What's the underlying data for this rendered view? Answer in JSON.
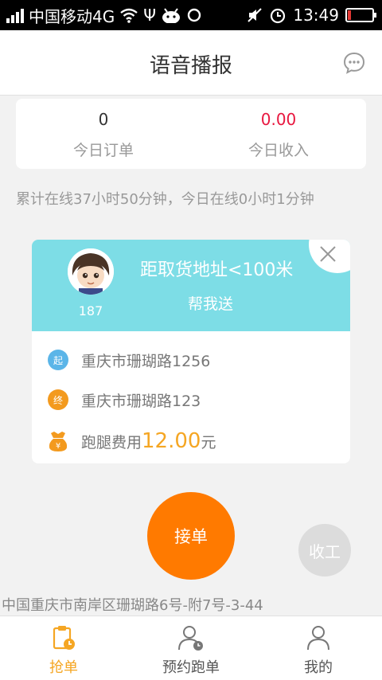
{
  "statusbar": {
    "carrier": "中国移动4G",
    "time": "13:49"
  },
  "header": {
    "title": "语音播报"
  },
  "stats": {
    "orders_value": "0",
    "orders_label": "今日订单",
    "income_value": "0.00",
    "income_label": "今日收入"
  },
  "online_text": "累计在线37小时50分钟，今日在线0小时1分钟",
  "order_card": {
    "user_id": "187",
    "distance": "距取货地址<100米",
    "type": "帮我送",
    "start_icon": "起",
    "start_address": "重庆市珊瑚路1256",
    "end_icon": "终",
    "end_address": "重庆市珊瑚路123",
    "fee_label": "跑腿费用",
    "fee_value": "12.00",
    "fee_unit": "元"
  },
  "actions": {
    "accept": "接单",
    "finish": "收工"
  },
  "current_address": "中国重庆市南岸区珊瑚路6号-附7号-3-44",
  "bottom_nav": {
    "items": [
      {
        "label": "抢单",
        "icon": "clipboard-clock-icon",
        "active": true
      },
      {
        "label": "预约跑单",
        "icon": "person-clock-icon",
        "active": false
      },
      {
        "label": "我的",
        "icon": "person-icon",
        "active": false
      }
    ]
  },
  "colors": {
    "accent_orange": "#ff7a00",
    "card_cyan": "#7ddde6",
    "income_red": "#e8173f",
    "fee_orange": "#f5a623"
  }
}
